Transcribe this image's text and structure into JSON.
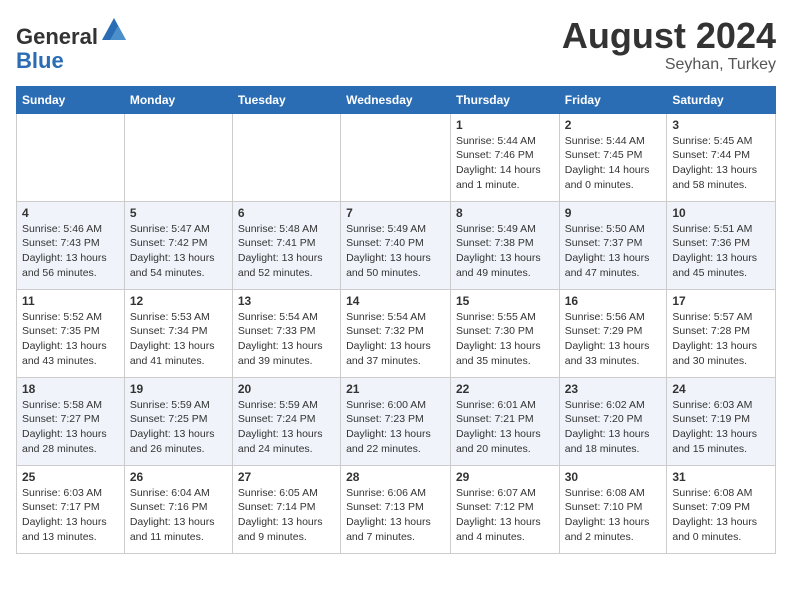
{
  "header": {
    "logo_line1": "General",
    "logo_line2": "Blue",
    "month_year": "August 2024",
    "location": "Seyhan, Turkey"
  },
  "weekdays": [
    "Sunday",
    "Monday",
    "Tuesday",
    "Wednesday",
    "Thursday",
    "Friday",
    "Saturday"
  ],
  "weeks": [
    [
      {
        "day": "",
        "info": ""
      },
      {
        "day": "",
        "info": ""
      },
      {
        "day": "",
        "info": ""
      },
      {
        "day": "",
        "info": ""
      },
      {
        "day": "1",
        "info": "Sunrise: 5:44 AM\nSunset: 7:46 PM\nDaylight: 14 hours\nand 1 minute."
      },
      {
        "day": "2",
        "info": "Sunrise: 5:44 AM\nSunset: 7:45 PM\nDaylight: 14 hours\nand 0 minutes."
      },
      {
        "day": "3",
        "info": "Sunrise: 5:45 AM\nSunset: 7:44 PM\nDaylight: 13 hours\nand 58 minutes."
      }
    ],
    [
      {
        "day": "4",
        "info": "Sunrise: 5:46 AM\nSunset: 7:43 PM\nDaylight: 13 hours\nand 56 minutes."
      },
      {
        "day": "5",
        "info": "Sunrise: 5:47 AM\nSunset: 7:42 PM\nDaylight: 13 hours\nand 54 minutes."
      },
      {
        "day": "6",
        "info": "Sunrise: 5:48 AM\nSunset: 7:41 PM\nDaylight: 13 hours\nand 52 minutes."
      },
      {
        "day": "7",
        "info": "Sunrise: 5:49 AM\nSunset: 7:40 PM\nDaylight: 13 hours\nand 50 minutes."
      },
      {
        "day": "8",
        "info": "Sunrise: 5:49 AM\nSunset: 7:38 PM\nDaylight: 13 hours\nand 49 minutes."
      },
      {
        "day": "9",
        "info": "Sunrise: 5:50 AM\nSunset: 7:37 PM\nDaylight: 13 hours\nand 47 minutes."
      },
      {
        "day": "10",
        "info": "Sunrise: 5:51 AM\nSunset: 7:36 PM\nDaylight: 13 hours\nand 45 minutes."
      }
    ],
    [
      {
        "day": "11",
        "info": "Sunrise: 5:52 AM\nSunset: 7:35 PM\nDaylight: 13 hours\nand 43 minutes."
      },
      {
        "day": "12",
        "info": "Sunrise: 5:53 AM\nSunset: 7:34 PM\nDaylight: 13 hours\nand 41 minutes."
      },
      {
        "day": "13",
        "info": "Sunrise: 5:54 AM\nSunset: 7:33 PM\nDaylight: 13 hours\nand 39 minutes."
      },
      {
        "day": "14",
        "info": "Sunrise: 5:54 AM\nSunset: 7:32 PM\nDaylight: 13 hours\nand 37 minutes."
      },
      {
        "day": "15",
        "info": "Sunrise: 5:55 AM\nSunset: 7:30 PM\nDaylight: 13 hours\nand 35 minutes."
      },
      {
        "day": "16",
        "info": "Sunrise: 5:56 AM\nSunset: 7:29 PM\nDaylight: 13 hours\nand 33 minutes."
      },
      {
        "day": "17",
        "info": "Sunrise: 5:57 AM\nSunset: 7:28 PM\nDaylight: 13 hours\nand 30 minutes."
      }
    ],
    [
      {
        "day": "18",
        "info": "Sunrise: 5:58 AM\nSunset: 7:27 PM\nDaylight: 13 hours\nand 28 minutes."
      },
      {
        "day": "19",
        "info": "Sunrise: 5:59 AM\nSunset: 7:25 PM\nDaylight: 13 hours\nand 26 minutes."
      },
      {
        "day": "20",
        "info": "Sunrise: 5:59 AM\nSunset: 7:24 PM\nDaylight: 13 hours\nand 24 minutes."
      },
      {
        "day": "21",
        "info": "Sunrise: 6:00 AM\nSunset: 7:23 PM\nDaylight: 13 hours\nand 22 minutes."
      },
      {
        "day": "22",
        "info": "Sunrise: 6:01 AM\nSunset: 7:21 PM\nDaylight: 13 hours\nand 20 minutes."
      },
      {
        "day": "23",
        "info": "Sunrise: 6:02 AM\nSunset: 7:20 PM\nDaylight: 13 hours\nand 18 minutes."
      },
      {
        "day": "24",
        "info": "Sunrise: 6:03 AM\nSunset: 7:19 PM\nDaylight: 13 hours\nand 15 minutes."
      }
    ],
    [
      {
        "day": "25",
        "info": "Sunrise: 6:03 AM\nSunset: 7:17 PM\nDaylight: 13 hours\nand 13 minutes."
      },
      {
        "day": "26",
        "info": "Sunrise: 6:04 AM\nSunset: 7:16 PM\nDaylight: 13 hours\nand 11 minutes."
      },
      {
        "day": "27",
        "info": "Sunrise: 6:05 AM\nSunset: 7:14 PM\nDaylight: 13 hours\nand 9 minutes."
      },
      {
        "day": "28",
        "info": "Sunrise: 6:06 AM\nSunset: 7:13 PM\nDaylight: 13 hours\nand 7 minutes."
      },
      {
        "day": "29",
        "info": "Sunrise: 6:07 AM\nSunset: 7:12 PM\nDaylight: 13 hours\nand 4 minutes."
      },
      {
        "day": "30",
        "info": "Sunrise: 6:08 AM\nSunset: 7:10 PM\nDaylight: 13 hours\nand 2 minutes."
      },
      {
        "day": "31",
        "info": "Sunrise: 6:08 AM\nSunset: 7:09 PM\nDaylight: 13 hours\nand 0 minutes."
      }
    ]
  ]
}
